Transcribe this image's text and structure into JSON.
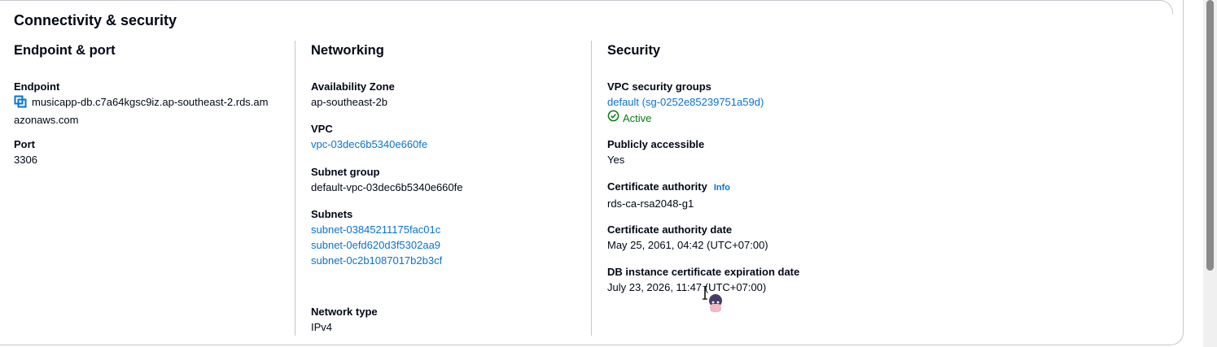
{
  "panel": {
    "title": "Connectivity & security"
  },
  "endpoint_port": {
    "heading": "Endpoint & port",
    "endpoint_label": "Endpoint",
    "endpoint_value": "musicapp-db.c7a64kgsc9iz.ap-southeast-2.rds.am",
    "endpoint_value_cont": "azonaws.com",
    "port_label": "Port",
    "port_value": "3306"
  },
  "networking": {
    "heading": "Networking",
    "az_label": "Availability Zone",
    "az_value": "ap-southeast-2b",
    "vpc_label": "VPC",
    "vpc_value": "vpc-03dec6b5340e660fe",
    "subnet_group_label": "Subnet group",
    "subnet_group_value": "default-vpc-03dec6b5340e660fe",
    "subnets_label": "Subnets",
    "subnets": [
      "subnet-03845211175fac01c",
      "subnet-0efd620d3f5302aa9",
      "subnet-0c2b1087017b2b3cf"
    ],
    "network_type_label": "Network type",
    "network_type_value": "IPv4"
  },
  "security": {
    "heading": "Security",
    "vpc_sg_label": "VPC security groups",
    "vpc_sg_value": "default (sg-0252e85239751a59d)",
    "vpc_sg_status": "Active",
    "public_label": "Publicly accessible",
    "public_value": "Yes",
    "ca_label": "Certificate authority",
    "ca_info": "Info",
    "ca_value": "rds-ca-rsa2048-g1",
    "ca_date_label": "Certificate authority date",
    "ca_date_value": "May 25, 2061, 04:42 (UTC+07:00)",
    "cert_exp_label": "DB instance certificate expiration date",
    "cert_exp_value": "July 23, 2026, 11:47 (UTC+07:00)"
  },
  "colors": {
    "link": "#0972d3",
    "success": "#037f0c",
    "text": "#000716",
    "border": "#c6c6cd"
  },
  "icons": {
    "copy": "copy-icon",
    "status": "check-circle-icon"
  }
}
